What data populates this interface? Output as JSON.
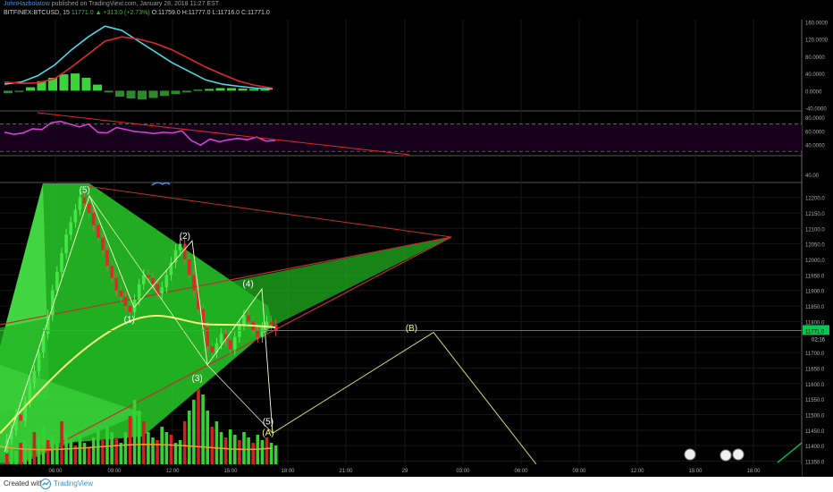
{
  "header": {
    "author": "JohnHazbolatow",
    "published_text": "published on TradingView.com, January 28, 2018 11:27 EST",
    "symbol": "BITFINEX:BTCUSD, 15",
    "last": "11771.0",
    "change": "▲ +313.0 (+2.73%)",
    "ohlc": "O:11759.0 H:11777.0 L:11716.0 C:11771.0"
  },
  "footer": {
    "created_with": "Created with",
    "brand": "TradingView"
  },
  "colors": {
    "background": "#000000",
    "price_line": "#00e676",
    "macd_fast": "#4dd8e8",
    "macd_slow": "#e0282a",
    "rsi": "#e040e0",
    "wave_label": "#ffffff",
    "abc_label": "#f5f57a",
    "triangle_fill": "#1ecf1e"
  },
  "chart_data": {
    "type": "candlestick",
    "symbol": "BITFINEX:BTCUSD",
    "interval": "15",
    "price_axis": {
      "ticks": [
        "12200.0",
        "12150.0",
        "12100.0",
        "12050.0",
        "12000.0",
        "11950.0",
        "11900.0",
        "11850.0",
        "11800.0",
        "11750.0",
        "11700.0",
        "11650.0",
        "11600.0",
        "11550.0",
        "11500.0",
        "11450.0",
        "11400.0",
        "11350.0"
      ],
      "range": [
        11340,
        12245
      ]
    },
    "current_price": {
      "label": "11771.0",
      "timer": "02:16",
      "value": 11771
    },
    "time_axis": {
      "labels": [
        "06:00",
        "09:00",
        "12:00",
        "15:00",
        "18:00",
        "21:00",
        "29",
        "03:00",
        "06:00",
        "09:00",
        "12:00",
        "15:00",
        "18:00"
      ]
    },
    "macd_panel": {
      "ticks": [
        "160.0000",
        "120.0000",
        "80.0000",
        "40.0000",
        "0.0000",
        "-40.0000"
      ],
      "range": [
        -45,
        165
      ],
      "fast": [
        15,
        20,
        35,
        60,
        95,
        125,
        150,
        140,
        115,
        90,
        65,
        45,
        25,
        15,
        10,
        6,
        4
      ],
      "slow": [
        20,
        17,
        18,
        28,
        55,
        85,
        115,
        125,
        120,
        110,
        95,
        75,
        55,
        38,
        22,
        12,
        6
      ],
      "histogram": [
        -6,
        -3,
        8,
        22,
        30,
        38,
        40,
        30,
        14,
        -4,
        -14,
        -18,
        -20,
        -17,
        -12,
        -8,
        -4,
        2,
        4,
        6,
        6,
        5,
        4,
        3
      ]
    },
    "rsi_panel": {
      "ticks": [
        "80.0000",
        "60.0000",
        "40.0000"
      ],
      "range": [
        25,
        88
      ],
      "levels": [
        70,
        30
      ],
      "values": [
        58,
        55,
        57,
        63,
        62,
        72,
        74,
        70,
        66,
        70,
        58,
        57,
        65,
        62,
        59,
        58,
        56,
        58,
        57,
        60,
        46,
        39,
        48,
        44,
        47,
        49,
        47,
        51,
        45,
        46
      ]
    },
    "lower_pane_tick": "40.00",
    "wave_labels": [
      {
        "text": "(5)",
        "t": 0.26,
        "price": 12215
      },
      {
        "text": "(1)",
        "t": 0.405,
        "price": 11797
      },
      {
        "text": "(2)",
        "t": 0.585,
        "price": 12067
      },
      {
        "text": "(3)",
        "t": 0.625,
        "price": 11608
      },
      {
        "text": "(4)",
        "t": 0.79,
        "price": 11912
      },
      {
        "text": "(5)",
        "t": 0.855,
        "price": 11468
      }
    ],
    "abc_labels": [
      {
        "text": "(A)",
        "t": 0.855,
        "price": 11432
      },
      {
        "text": "(B)",
        "t": 1.32,
        "price": 11770
      }
    ]
  }
}
